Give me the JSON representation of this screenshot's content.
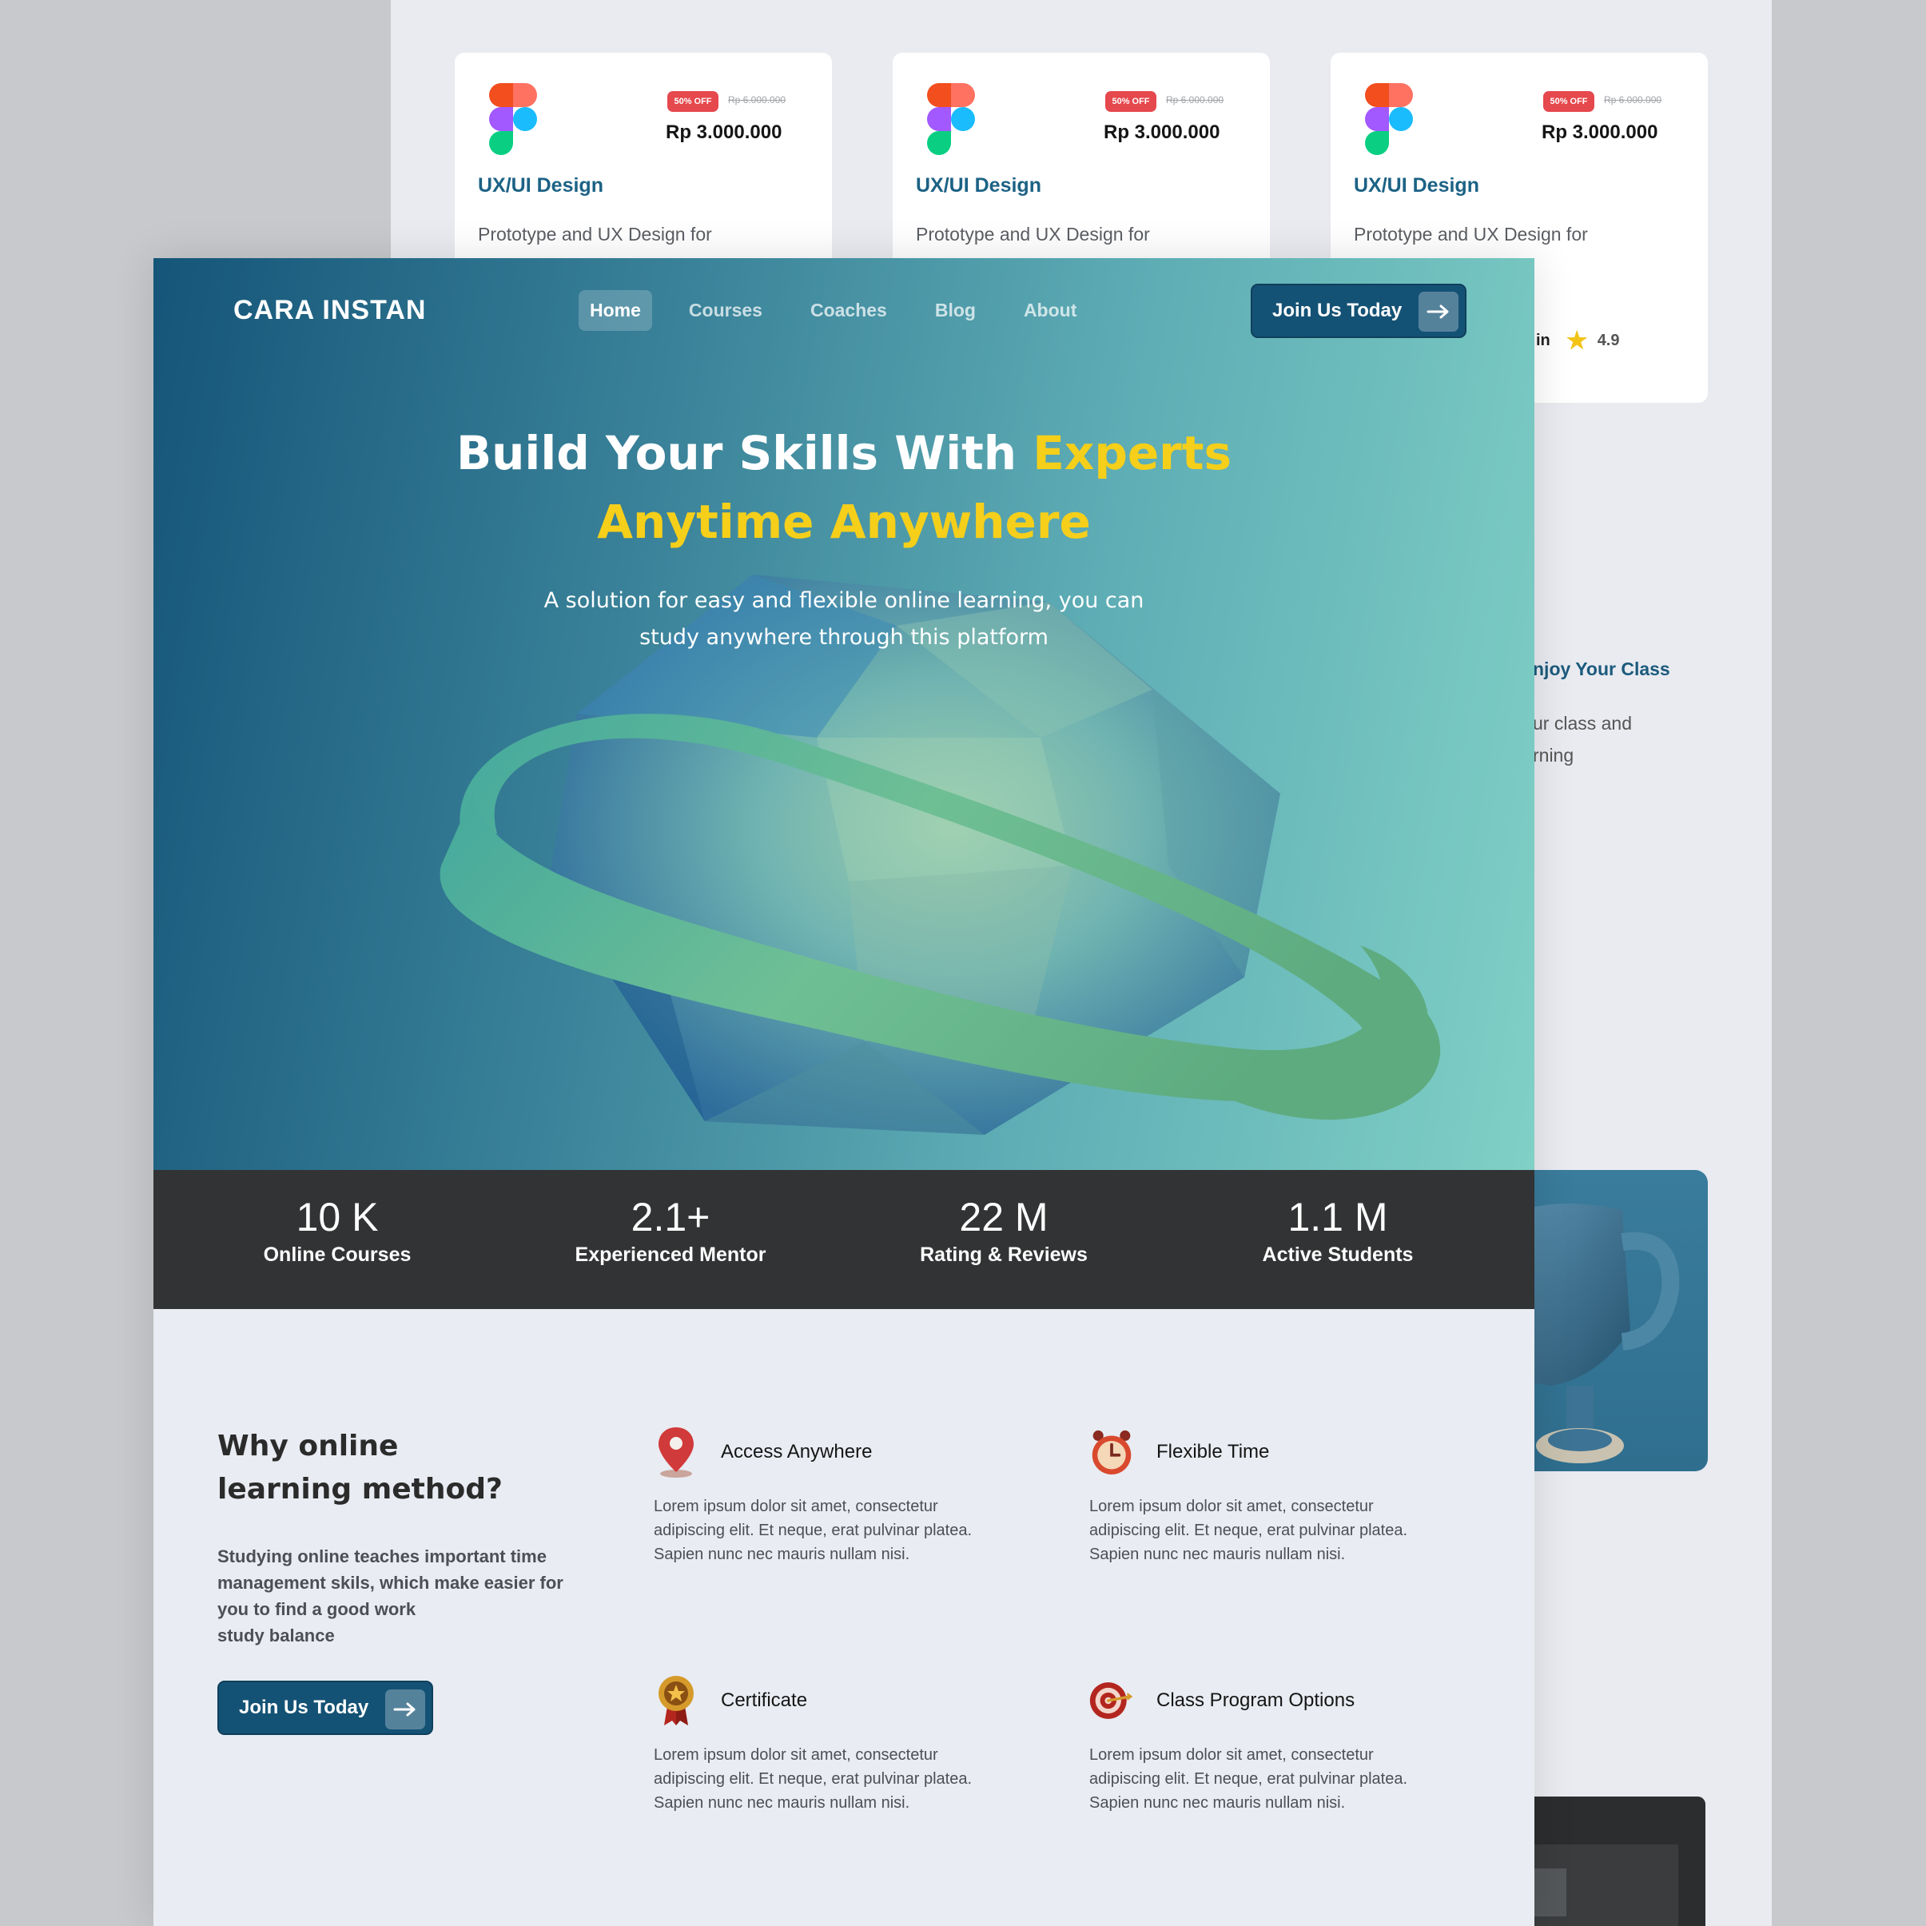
{
  "background_page": {
    "course_cards": [
      {
        "badge": "50% OFF",
        "old_price": "Rp 6.000.000",
        "price": "Rp 3.000.000",
        "title": "UX/UI Design",
        "desc": "Prototype and UX Design for"
      },
      {
        "badge": "50% OFF",
        "old_price": "Rp 6.000.000",
        "price": "Rp 3.000.000",
        "title": "UX/UI Design",
        "desc": "Prototype and UX Design for"
      },
      {
        "badge": "50% OFF",
        "old_price": "Rp 6.000.000",
        "price": "Rp 3.000.000",
        "title": "UX/UI Design",
        "desc": "Prototype and UX Design for",
        "rating_prefix": "in",
        "rating": "4.9"
      }
    ],
    "enjoy": {
      "title": "njoy Your Class",
      "line1": "ur class and",
      "line2": "rning"
    }
  },
  "header": {
    "brand": "CARA INSTAN",
    "nav": [
      {
        "label": "Home",
        "active": true
      },
      {
        "label": "Courses"
      },
      {
        "label": "Coaches"
      },
      {
        "label": "Blog"
      },
      {
        "label": "About"
      }
    ],
    "cta": "Join Us Today"
  },
  "hero": {
    "title_line1_white": "Build Your Skills With ",
    "title_line1_yellow": "Experts",
    "title_line2": "Anytime Anywhere",
    "subtitle_line1": "A solution for easy and flexible online learning, you can",
    "subtitle_line2": "study anywhere through this platform"
  },
  "stats": [
    {
      "value": "10 K",
      "label": "Online Courses"
    },
    {
      "value": "2.1+",
      "label": "Experienced Mentor"
    },
    {
      "value": "22 M",
      "label": "Rating & Reviews"
    },
    {
      "value": "1.1 M",
      "label": "Active Students"
    }
  ],
  "why": {
    "title_line1": "Why online",
    "title_line2": "learning method?",
    "desc_line1": "Studying online teaches important time",
    "desc_line2": "management skils, which make easier for",
    "desc_line3": "you to find a good work",
    "desc_line4": "study balance",
    "cta": "Join Us Today"
  },
  "features": [
    {
      "icon": "location-pin-icon",
      "title": "Access Anywhere",
      "line1": "Lorem ipsum dolor sit amet, consectetur",
      "line2": "adipiscing elit. Et neque, erat pulvinar platea.",
      "line3": "Sapien nunc nec mauris nullam nisi."
    },
    {
      "icon": "alarm-clock-icon",
      "title": "Flexible Time",
      "line1": "Lorem ipsum dolor sit amet, consectetur",
      "line2": "adipiscing elit. Et neque, erat pulvinar platea.",
      "line3": "Sapien nunc nec mauris nullam nisi."
    },
    {
      "icon": "medal-icon",
      "title": "Certificate",
      "line1": "Lorem ipsum dolor sit amet, consectetur",
      "line2": "adipiscing elit. Et neque, erat pulvinar platea.",
      "line3": "Sapien nunc nec mauris nullam nisi."
    },
    {
      "icon": "target-icon",
      "title": "Class Program Options",
      "line1": "Lorem ipsum dolor sit amet, consectetur",
      "line2": "adipiscing elit. Et neque, erat pulvinar platea.",
      "line3": "Sapien nunc nec mauris nullam nisi."
    }
  ],
  "colors": {
    "brand_dark": "#145275",
    "accent_yellow": "#f6cf1a",
    "stats_bar": "#323334",
    "badge_red": "#e5484d"
  }
}
